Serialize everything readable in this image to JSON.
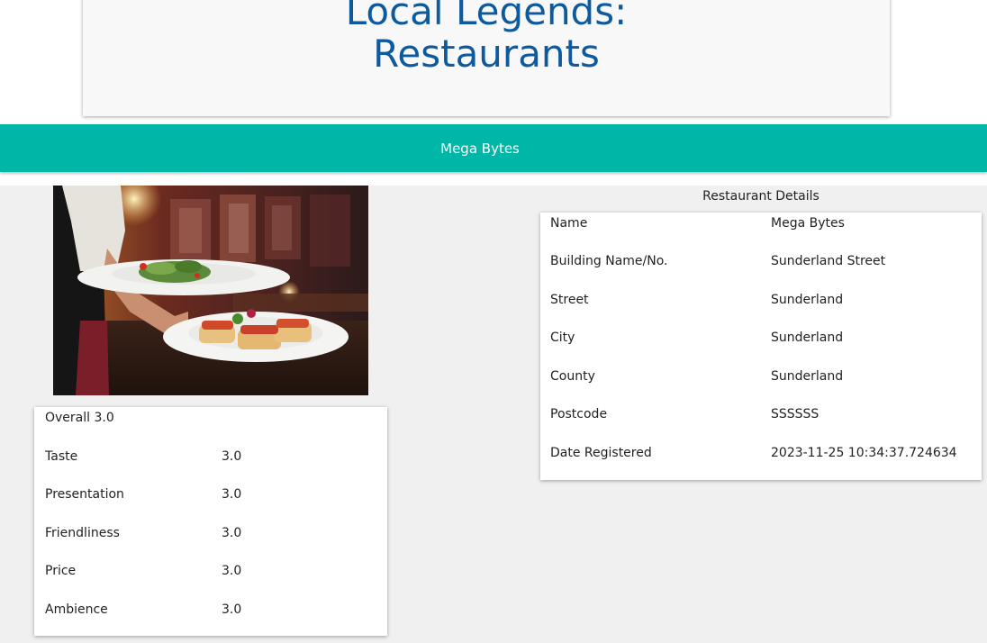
{
  "header": {
    "title_line1": "Local Legends:",
    "title_line2": "Restaurants"
  },
  "nav": {
    "restaurant_link": "Mega Bytes"
  },
  "photo": {
    "alt": "Waiter carrying plates of salad and bruschetta"
  },
  "ratings": {
    "overall": "Overall 3.0",
    "rows": [
      {
        "label": "Taste",
        "value": "3.0"
      },
      {
        "label": "Presentation",
        "value": "3.0"
      },
      {
        "label": "Friendliness",
        "value": "3.0"
      },
      {
        "label": "Price",
        "value": "3.0"
      },
      {
        "label": "Ambience",
        "value": "3.0"
      }
    ]
  },
  "details": {
    "heading": "Restaurant Details",
    "rows": [
      {
        "label": "Name",
        "value": "Mega Bytes"
      },
      {
        "label": "Building Name/No.",
        "value": "Sunderland Street"
      },
      {
        "label": "Street",
        "value": "Sunderland"
      },
      {
        "label": "City",
        "value": "Sunderland"
      },
      {
        "label": "County",
        "value": "Sunderland"
      },
      {
        "label": "Postcode",
        "value": "SSSSSS"
      },
      {
        "label": "Date Registered",
        "value": "2023-11-25 10:34:37.724634"
      }
    ]
  },
  "colors": {
    "title": "#0d5a9e",
    "nav_bar": "#00b6a6",
    "content_bg": "#f0f0f0"
  }
}
